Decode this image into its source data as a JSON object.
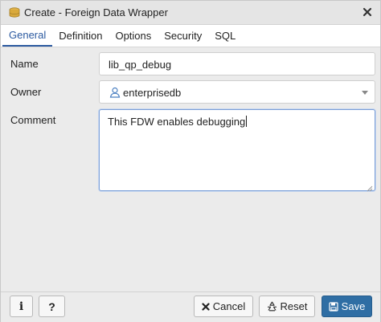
{
  "window": {
    "title": "Create - Foreign Data Wrapper",
    "title_icon": "fdw-database-icon"
  },
  "tabs": [
    {
      "label": "General",
      "active": true
    },
    {
      "label": "Definition",
      "active": false
    },
    {
      "label": "Options",
      "active": false
    },
    {
      "label": "Security",
      "active": false
    },
    {
      "label": "SQL",
      "active": false
    }
  ],
  "form": {
    "name": {
      "label": "Name",
      "value": "lib_qp_debug"
    },
    "owner": {
      "label": "Owner",
      "value": "enterprisedb",
      "icon": "user-icon"
    },
    "comment": {
      "label": "Comment",
      "value": "This FDW enables debugging"
    }
  },
  "footer": {
    "info_label": "i",
    "help_label": "?",
    "cancel_label": "Cancel",
    "reset_label": "Reset",
    "save_label": "Save"
  },
  "colors": {
    "accent": "#2c5aa0",
    "save_button": "#2f6ea4"
  }
}
